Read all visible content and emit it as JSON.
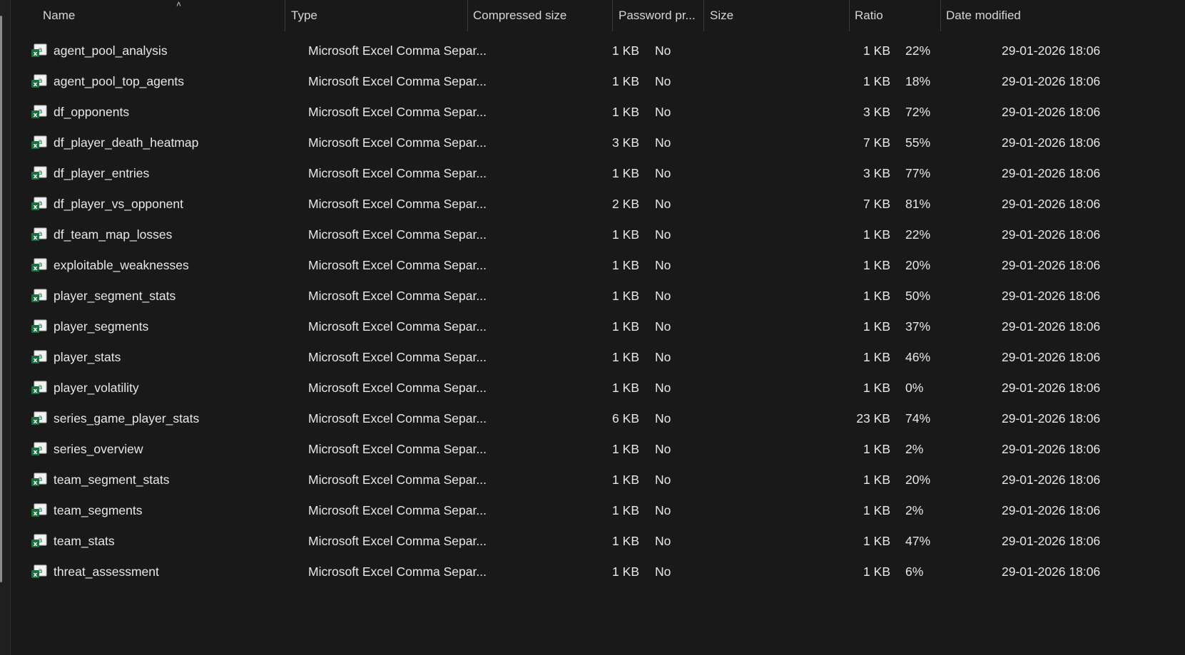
{
  "columns": {
    "name": "Name",
    "type": "Type",
    "compressed_size": "Compressed size",
    "password_protected": "Password pr...",
    "size": "Size",
    "ratio": "Ratio",
    "date_modified": "Date modified"
  },
  "sort": {
    "column": "name",
    "direction": "ascending",
    "icon": "chevron-up-icon"
  },
  "file_icon": "excel-csv-icon",
  "rows": [
    {
      "name": "agent_pool_analysis",
      "type": "Microsoft Excel Comma Separ...",
      "compressed_size": "1 KB",
      "password": "No",
      "size": "1 KB",
      "ratio": "22%",
      "date": "29-01-2026 18:06"
    },
    {
      "name": "agent_pool_top_agents",
      "type": "Microsoft Excel Comma Separ...",
      "compressed_size": "1 KB",
      "password": "No",
      "size": "1 KB",
      "ratio": "18%",
      "date": "29-01-2026 18:06"
    },
    {
      "name": "df_opponents",
      "type": "Microsoft Excel Comma Separ...",
      "compressed_size": "1 KB",
      "password": "No",
      "size": "3 KB",
      "ratio": "72%",
      "date": "29-01-2026 18:06"
    },
    {
      "name": "df_player_death_heatmap",
      "type": "Microsoft Excel Comma Separ...",
      "compressed_size": "3 KB",
      "password": "No",
      "size": "7 KB",
      "ratio": "55%",
      "date": "29-01-2026 18:06"
    },
    {
      "name": "df_player_entries",
      "type": "Microsoft Excel Comma Separ...",
      "compressed_size": "1 KB",
      "password": "No",
      "size": "3 KB",
      "ratio": "77%",
      "date": "29-01-2026 18:06"
    },
    {
      "name": "df_player_vs_opponent",
      "type": "Microsoft Excel Comma Separ...",
      "compressed_size": "2 KB",
      "password": "No",
      "size": "7 KB",
      "ratio": "81%",
      "date": "29-01-2026 18:06"
    },
    {
      "name": "df_team_map_losses",
      "type": "Microsoft Excel Comma Separ...",
      "compressed_size": "1 KB",
      "password": "No",
      "size": "1 KB",
      "ratio": "22%",
      "date": "29-01-2026 18:06"
    },
    {
      "name": "exploitable_weaknesses",
      "type": "Microsoft Excel Comma Separ...",
      "compressed_size": "1 KB",
      "password": "No",
      "size": "1 KB",
      "ratio": "20%",
      "date": "29-01-2026 18:06"
    },
    {
      "name": "player_segment_stats",
      "type": "Microsoft Excel Comma Separ...",
      "compressed_size": "1 KB",
      "password": "No",
      "size": "1 KB",
      "ratio": "50%",
      "date": "29-01-2026 18:06"
    },
    {
      "name": "player_segments",
      "type": "Microsoft Excel Comma Separ...",
      "compressed_size": "1 KB",
      "password": "No",
      "size": "1 KB",
      "ratio": "37%",
      "date": "29-01-2026 18:06"
    },
    {
      "name": "player_stats",
      "type": "Microsoft Excel Comma Separ...",
      "compressed_size": "1 KB",
      "password": "No",
      "size": "1 KB",
      "ratio": "46%",
      "date": "29-01-2026 18:06"
    },
    {
      "name": "player_volatility",
      "type": "Microsoft Excel Comma Separ...",
      "compressed_size": "1 KB",
      "password": "No",
      "size": "1 KB",
      "ratio": "0%",
      "date": "29-01-2026 18:06"
    },
    {
      "name": "series_game_player_stats",
      "type": "Microsoft Excel Comma Separ...",
      "compressed_size": "6 KB",
      "password": "No",
      "size": "23 KB",
      "ratio": "74%",
      "date": "29-01-2026 18:06"
    },
    {
      "name": "series_overview",
      "type": "Microsoft Excel Comma Separ...",
      "compressed_size": "1 KB",
      "password": "No",
      "size": "1 KB",
      "ratio": "2%",
      "date": "29-01-2026 18:06"
    },
    {
      "name": "team_segment_stats",
      "type": "Microsoft Excel Comma Separ...",
      "compressed_size": "1 KB",
      "password": "No",
      "size": "1 KB",
      "ratio": "20%",
      "date": "29-01-2026 18:06"
    },
    {
      "name": "team_segments",
      "type": "Microsoft Excel Comma Separ...",
      "compressed_size": "1 KB",
      "password": "No",
      "size": "1 KB",
      "ratio": "2%",
      "date": "29-01-2026 18:06"
    },
    {
      "name": "team_stats",
      "type": "Microsoft Excel Comma Separ...",
      "compressed_size": "1 KB",
      "password": "No",
      "size": "1 KB",
      "ratio": "47%",
      "date": "29-01-2026 18:06"
    },
    {
      "name": "threat_assessment",
      "type": "Microsoft Excel Comma Separ...",
      "compressed_size": "1 KB",
      "password": "No",
      "size": "1 KB",
      "ratio": "6%",
      "date": "29-01-2026 18:06"
    }
  ]
}
